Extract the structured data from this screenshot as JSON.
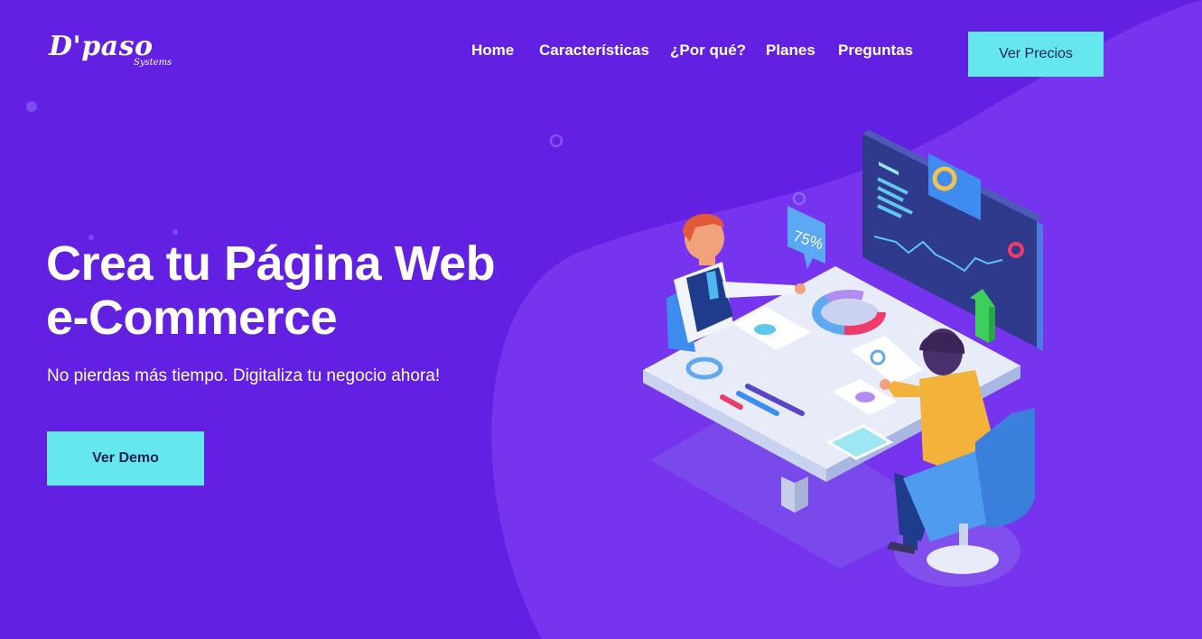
{
  "brand": {
    "name": "D'paso",
    "tagline": "Systems"
  },
  "nav": {
    "items": [
      {
        "label": "Home"
      },
      {
        "label": "Características"
      },
      {
        "label": "¿Por qué?"
      },
      {
        "label": "Planes"
      },
      {
        "label": "Preguntas"
      }
    ],
    "cta_label": "Ver Precios"
  },
  "hero": {
    "title_line1": "Crea tu Página Web",
    "title_line2": "e-Commerce",
    "subtitle": "No pierdas más tiempo. Digitaliza tu negocio ahora!",
    "cta_label": "Ver Demo"
  },
  "illustration": {
    "badge_text": "75%"
  },
  "colors": {
    "background": "#6120e2",
    "background_shape": "#7633ef",
    "accent": "#65e7f0",
    "button_text": "#20244a"
  }
}
